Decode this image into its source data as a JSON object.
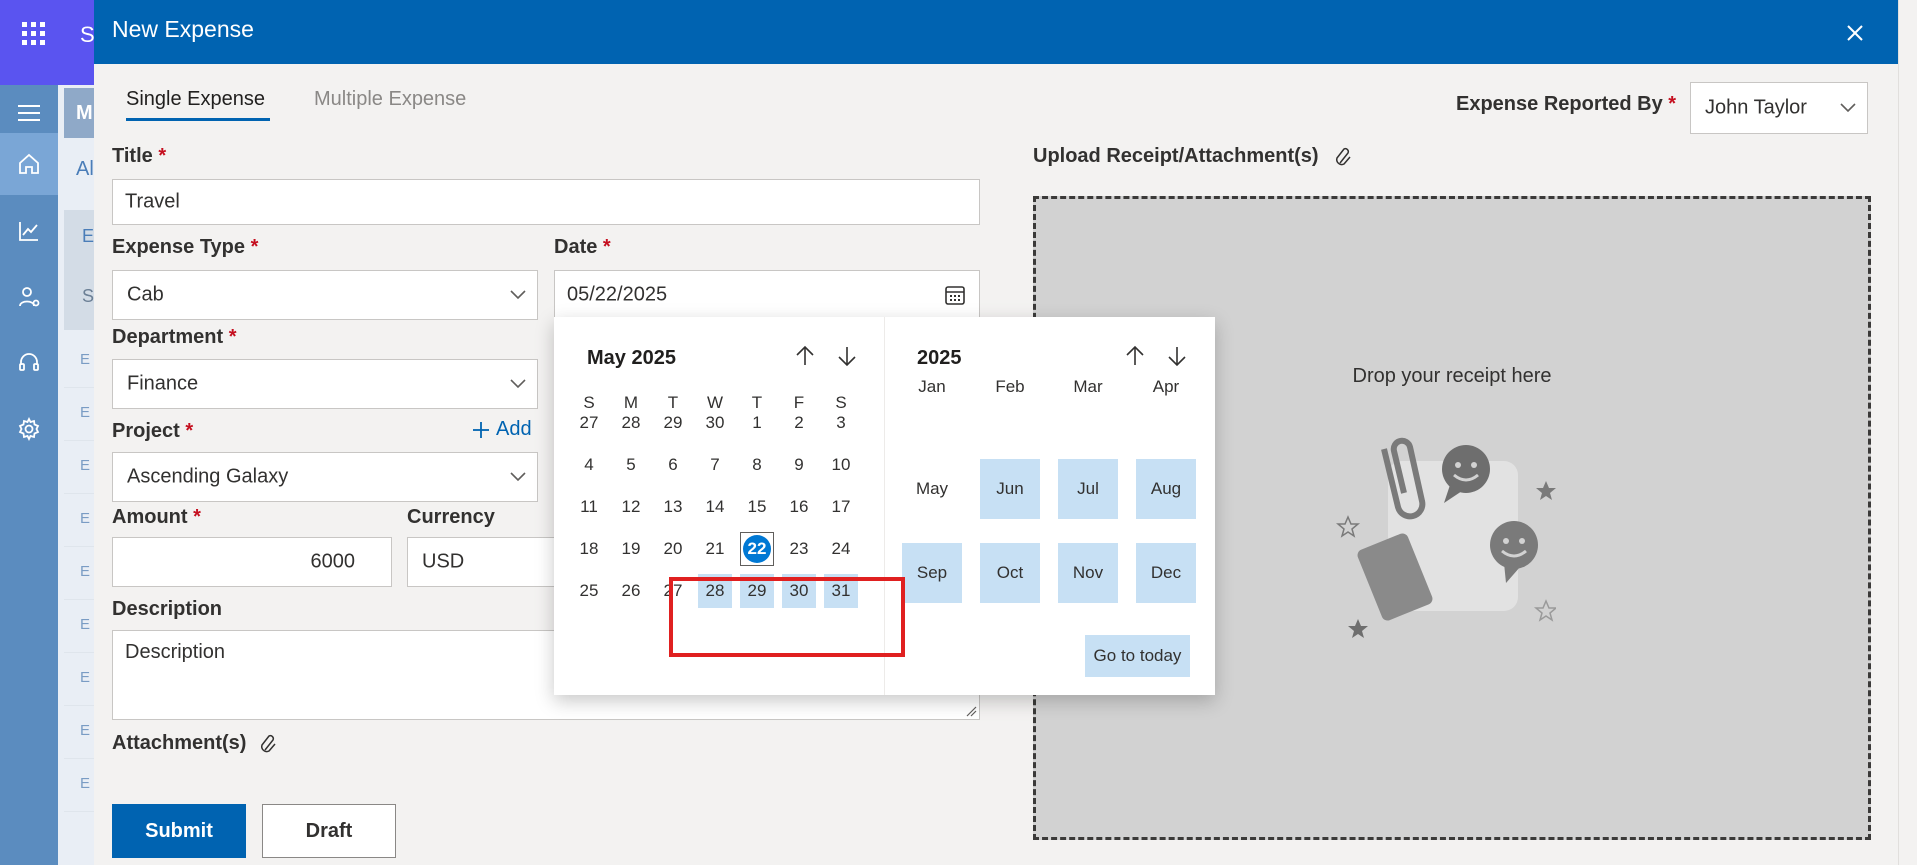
{
  "background": {
    "app_title_initial": "S",
    "panel_header_initial": "M",
    "tab_initial": "Al",
    "column_initial": "E",
    "search_initial": "S",
    "row_initials": [
      "E",
      "E",
      "E",
      "E",
      "E",
      "E",
      "E",
      "E",
      "E"
    ]
  },
  "dialog": {
    "title": "New Expense",
    "tabs": [
      "Single Expense",
      "Multiple Expense"
    ],
    "reported_by": {
      "label": "Expense Reported By",
      "required": "*",
      "value": "John Taylor"
    },
    "title_field": {
      "label": "Title",
      "required": "*",
      "value": "Travel"
    },
    "expense_type": {
      "label": "Expense Type",
      "required": "*",
      "value": "Cab"
    },
    "date": {
      "label": "Date",
      "required": "*",
      "value": "05/22/2025"
    },
    "department": {
      "label": "Department",
      "required": "*",
      "value": "Finance"
    },
    "project": {
      "label": "Project",
      "required": "*",
      "value": "Ascending Galaxy",
      "add_label": "Add"
    },
    "amount": {
      "label": "Amount",
      "required": "*",
      "value": "6000"
    },
    "currency": {
      "label": "Currency",
      "value": "USD"
    },
    "description": {
      "label": "Description",
      "placeholder": "Description"
    },
    "attachments": {
      "label": "Attachment(s)"
    },
    "upload": {
      "label": "Upload Receipt/Attachment(s)",
      "drop_text": "Drop your receipt here"
    },
    "buttons": {
      "submit": "Submit",
      "draft": "Draft"
    }
  },
  "date_picker": {
    "month_title": "May 2025",
    "weekdays": [
      "S",
      "M",
      "T",
      "W",
      "T",
      "F",
      "S"
    ],
    "weeks": [
      [
        "27",
        "28",
        "29",
        "30",
        "1",
        "2",
        "3"
      ],
      [
        "4",
        "5",
        "6",
        "7",
        "8",
        "9",
        "10"
      ],
      [
        "11",
        "12",
        "13",
        "14",
        "15",
        "16",
        "17"
      ],
      [
        "18",
        "19",
        "20",
        "21",
        "22",
        "23",
        "24"
      ],
      [
        "25",
        "26",
        "27",
        "28",
        "29",
        "30",
        "31"
      ]
    ],
    "selected_day": "22",
    "highlighted_days": [
      "28",
      "29",
      "30",
      "31"
    ],
    "year_title": "2025",
    "months": [
      "Jan",
      "Feb",
      "Mar",
      "Apr",
      "May",
      "Jun",
      "Jul",
      "Aug",
      "Sep",
      "Oct",
      "Nov",
      "Dec"
    ],
    "highlighted_months": [
      "Jun",
      "Jul",
      "Aug",
      "Sep",
      "Oct",
      "Nov",
      "Dec"
    ],
    "go_to_today": "Go to today"
  },
  "colors": {
    "dialog_header": "#0063b1",
    "highlight": "#c7e0f4",
    "selected_day": "#0078d4",
    "annotation_box": "#e02020"
  }
}
